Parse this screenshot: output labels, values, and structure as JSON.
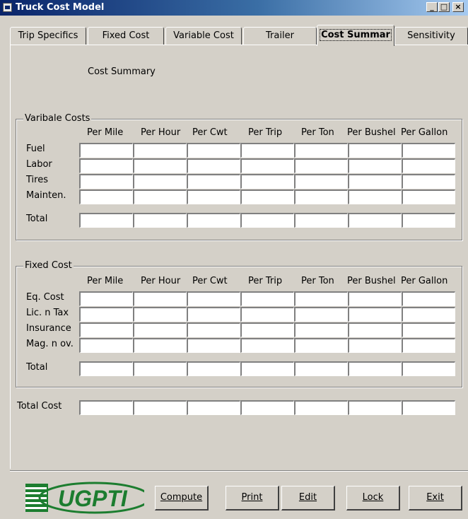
{
  "window": {
    "title": "Truck Cost Model",
    "controls": [
      "_",
      "□",
      "×"
    ]
  },
  "tabs": [
    {
      "label": "Trip Specifics"
    },
    {
      "label": "Fixed Cost"
    },
    {
      "label": "Variable Cost"
    },
    {
      "label": "Trailer"
    },
    {
      "label": "Cost Summar",
      "active": true
    },
    {
      "label": "Sensitivity"
    }
  ],
  "panel_title": "Cost Summary",
  "columns": [
    "Per Mile",
    "Per Hour",
    "Per Cwt",
    "Per Trip",
    "Per Ton",
    "Per Bushel",
    "Per Gallon"
  ],
  "variable_costs": {
    "legend": "Varibale Costs",
    "rows": [
      "Fuel",
      "Labor",
      "Tires",
      "Mainten."
    ],
    "total_label": "Total"
  },
  "fixed_cost": {
    "legend": "Fixed Cost",
    "rows": [
      "Eq. Cost",
      "Lic. n Tax",
      "Insurance",
      "Mag. n ov."
    ],
    "total_label": "Total"
  },
  "total_cost_label": "Total Cost",
  "logo_text": "UGPTI",
  "buttons": {
    "compute": "Compute",
    "print": "Print",
    "edit": "Edit",
    "lock": "Lock",
    "exit": "Exit"
  }
}
